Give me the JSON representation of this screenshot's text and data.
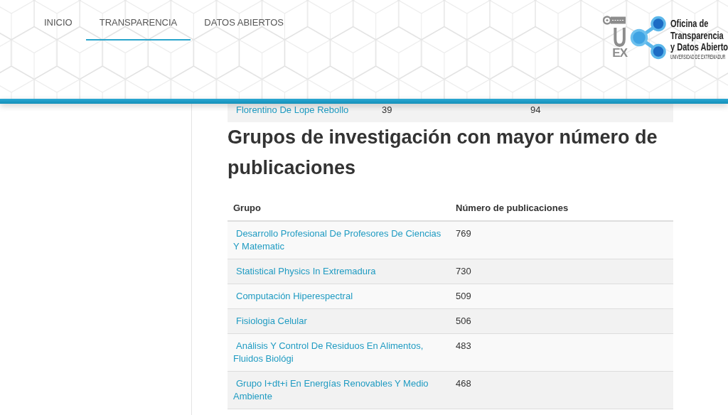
{
  "nav": [
    {
      "label": "INICIO",
      "selected": false
    },
    {
      "label": "TRANSPARENCIA",
      "selected": true
    },
    {
      "label": "DATOS ABIERTOS",
      "selected": false
    }
  ],
  "logo": {
    "monogram": "U",
    "monogram_sub": "EX",
    "title_lines": [
      "Oficina de",
      "Transparencia",
      "y Datos Abierto"
    ],
    "tagline": "UNIVERSIDAD DE EXTREMADUR"
  },
  "previous_table": {
    "rows": [
      [
        "Florentino De Lope Rebollo",
        "39",
        "94"
      ]
    ]
  },
  "section": {
    "title": "Grupos de investigación con mayor número de publicaciones",
    "table": {
      "columns": [
        "Grupo",
        "Número de publicaciones"
      ],
      "rows": [
        {
          "group": "Desarrollo Profesional De Profesores De Ciencias Y Matematic",
          "publications": "769"
        },
        {
          "group": "Statistical Physics In Extremadura",
          "publications": "730"
        },
        {
          "group": "Computación Hiperespectral",
          "publications": "509"
        },
        {
          "group": "Fisiologia Celular",
          "publications": "506"
        },
        {
          "group": "Análisis Y Control De Residuos En Alimentos, Fluidos Biológi",
          "publications": "483"
        },
        {
          "group": "Grupo I+dt+i En Energías Renovables Y Medio Ambiente",
          "publications": "468"
        }
      ]
    }
  }
}
